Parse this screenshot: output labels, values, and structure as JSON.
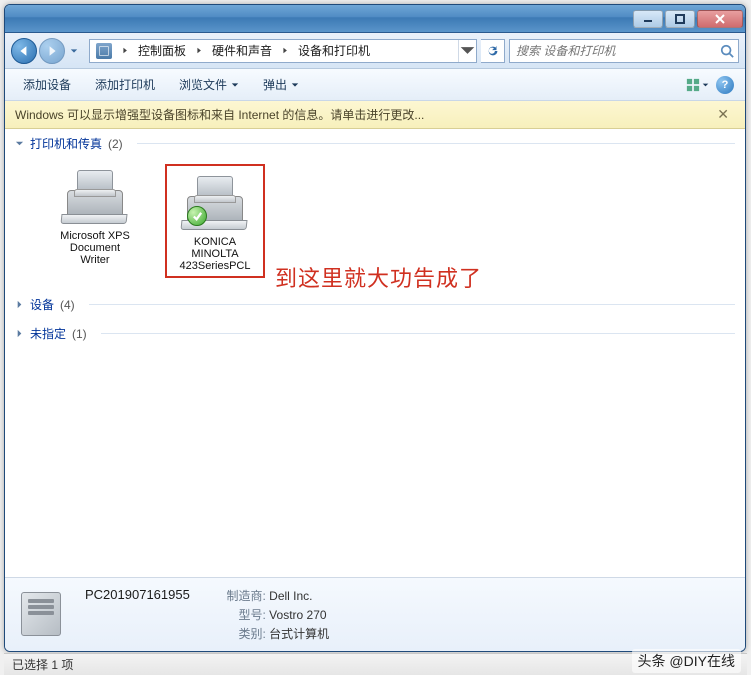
{
  "breadcrumb": {
    "seg1": "控制面板",
    "seg2": "硬件和声音",
    "seg3": "设备和打印机"
  },
  "search": {
    "placeholder": "搜索 设备和打印机"
  },
  "toolbar": {
    "add_device": "添加设备",
    "add_printer": "添加打印机",
    "browse_files": "浏览文件",
    "eject": "弹出"
  },
  "infobar": {
    "message": "Windows 可以显示增强型设备图标和来自 Internet 的信息。请单击进行更改..."
  },
  "groups": {
    "printers": {
      "label": "打印机和传真",
      "count": "(2)"
    },
    "devices": {
      "label": "设备",
      "count": "(4)"
    },
    "unspecified": {
      "label": "未指定",
      "count": "(1)"
    }
  },
  "items": {
    "xps": {
      "line1": "Microsoft XPS",
      "line2": "Document",
      "line3": "Writer"
    },
    "konica": {
      "line1": "KONICA",
      "line2": "MINOLTA",
      "line3": "423SeriesPCL"
    }
  },
  "annotation": "到这里就大功告成了",
  "details": {
    "name": "PC201907161955",
    "mfr_label": "制造商:",
    "mfr_val": "Dell Inc.",
    "model_label": "型号:",
    "model_val": "Vostro 270",
    "cat_label": "类别:",
    "cat_val": "台式计算机"
  },
  "status": {
    "text": "已选择 1 项"
  },
  "watermark": "头条 @DIY在线"
}
